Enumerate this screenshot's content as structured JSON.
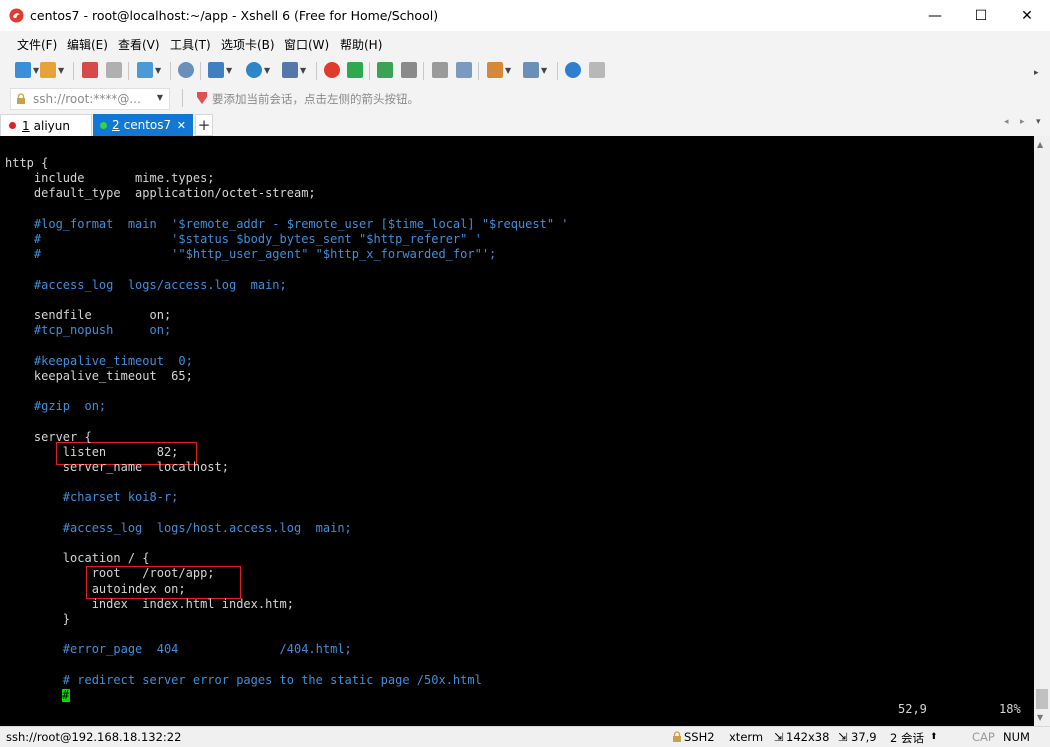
{
  "window": {
    "title": "centos7 - root@localhost:~/app - Xshell 6 (Free for Home/School)",
    "minimize": "—",
    "maximize": "☐",
    "close": "✕"
  },
  "menu": [
    "文件(F)",
    "编辑(E)",
    "查看(V)",
    "工具(T)",
    "选项卡(B)",
    "窗口(W)",
    "帮助(H)"
  ],
  "address": {
    "value": "ssh://root:****@...",
    "hint": "要添加当前会话，点击左侧的箭头按钮。"
  },
  "tabs": [
    {
      "num": "1",
      "label": "aliyun"
    },
    {
      "num": "2",
      "label": "centos7",
      "close": "✕"
    }
  ],
  "tab_add": "+",
  "terminal": {
    "lines": [
      {
        "text": "http {",
        "style": "normal"
      },
      {
        "text": "    include       mime.types;",
        "style": "normal"
      },
      {
        "text": "    default_type  application/octet-stream;",
        "style": "normal"
      },
      {
        "text": "",
        "style": "normal"
      },
      {
        "text": "    #log_format  main  '$remote_addr - $remote_user [$time_local] \"$request\" '",
        "style": "comment"
      },
      {
        "text": "    #                  '$status $body_bytes_sent \"$http_referer\" '",
        "style": "comment"
      },
      {
        "text": "    #                  '\"$http_user_agent\" \"$http_x_forwarded_for\"';",
        "style": "comment"
      },
      {
        "text": "",
        "style": "normal"
      },
      {
        "text": "    #access_log  logs/access.log  main;",
        "style": "comment"
      },
      {
        "text": "",
        "style": "normal"
      },
      {
        "text": "    sendfile        on;",
        "style": "normal"
      },
      {
        "text": "    #tcp_nopush     on;",
        "style": "comment"
      },
      {
        "text": "",
        "style": "normal"
      },
      {
        "text": "    #keepalive_timeout  0;",
        "style": "comment"
      },
      {
        "text": "    keepalive_timeout  65;",
        "style": "normal"
      },
      {
        "text": "",
        "style": "normal"
      },
      {
        "text": "    #gzip  on;",
        "style": "comment"
      },
      {
        "text": "",
        "style": "normal"
      },
      {
        "text": "    server {",
        "style": "normal"
      },
      {
        "text": "        listen       82;",
        "style": "normal"
      },
      {
        "text": "        server_name  localhost;",
        "style": "normal"
      },
      {
        "text": "",
        "style": "normal"
      },
      {
        "text": "        #charset koi8-r;",
        "style": "comment"
      },
      {
        "text": "",
        "style": "normal"
      },
      {
        "text": "        #access_log  logs/host.access.log  main;",
        "style": "comment"
      },
      {
        "text": "",
        "style": "normal"
      },
      {
        "text": "        location / {",
        "style": "normal"
      },
      {
        "text": "            root   /root/app;",
        "style": "normal"
      },
      {
        "text": "            autoindex on;",
        "style": "normal"
      },
      {
        "text": "            index  index.html index.htm;",
        "style": "normal"
      },
      {
        "text": "        }",
        "style": "normal"
      },
      {
        "text": "",
        "style": "normal"
      },
      {
        "text": "        #error_page  404              /404.html;",
        "style": "comment"
      },
      {
        "text": "",
        "style": "normal"
      },
      {
        "text": "        # redirect server error pages to the static page /50x.html",
        "style": "comment"
      },
      {
        "text": "        #",
        "style": "cursor"
      }
    ],
    "position": "52,9",
    "percent": "18%"
  },
  "status": {
    "connection": "ssh://root@192.168.18.132:22",
    "protocol": "SSH2",
    "term": "xterm",
    "size": "142x38",
    "cursor": "37,9",
    "sessions": "2 会话",
    "cap": "CAP",
    "num": "NUM"
  },
  "colors": {
    "tab_active": "#1178d4",
    "comment": "#3d8fdc",
    "highlight_box": "#e02020",
    "cursor": "#00e000"
  }
}
